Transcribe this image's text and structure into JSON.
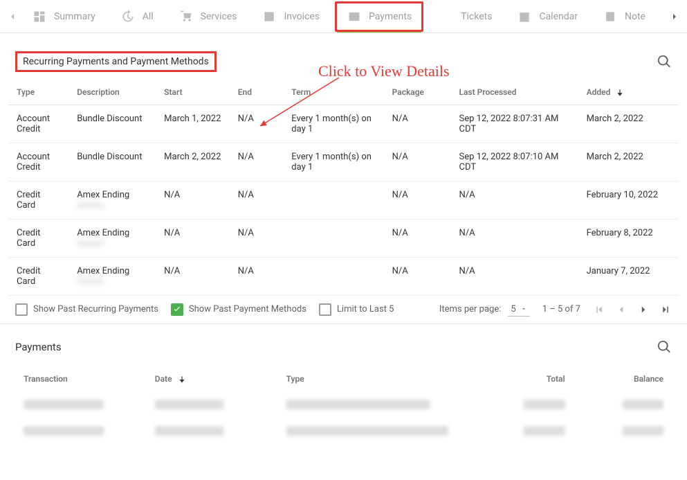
{
  "tabs": [
    {
      "label": "Summary",
      "icon": "dashboard",
      "active": false
    },
    {
      "label": "All",
      "icon": "history",
      "active": false
    },
    {
      "label": "Services",
      "icon": "cart",
      "active": false
    },
    {
      "label": "Invoices",
      "icon": "image",
      "active": false
    },
    {
      "label": "Payments",
      "icon": "card",
      "active": true
    },
    {
      "label": "Tickets",
      "icon": "ticket",
      "active": false
    },
    {
      "label": "Calendar",
      "icon": "calendar",
      "active": false
    },
    {
      "label": "Note",
      "icon": "note",
      "active": false
    }
  ],
  "annotation": "Click to View Details",
  "recurring": {
    "title": "Recurring Payments and Payment Methods",
    "columns": [
      "Type",
      "Description",
      "Start",
      "End",
      "Term",
      "Package",
      "Last Processed",
      "Added"
    ],
    "sort_column": "Added",
    "rows": [
      {
        "type": "Account Credit",
        "description": "Bundle Discount",
        "start": "March 1, 2022",
        "end": "N/A",
        "term": "Every 1 month(s) on day 1",
        "package": "N/A",
        "last_processed": "Sep 12, 2022 8:07:31 AM CDT",
        "added": "March 2, 2022",
        "desc_blur": false
      },
      {
        "type": "Account Credit",
        "description": "Bundle Discount",
        "start": "March 2, 2022",
        "end": "N/A",
        "term": "Every 1 month(s) on day 1",
        "package": "N/A",
        "last_processed": "Sep 12, 2022 8:07:10 AM CDT",
        "added": "March 2, 2022",
        "desc_blur": false
      },
      {
        "type": "Credit Card",
        "description": "Amex Ending",
        "start": "N/A",
        "end": "N/A",
        "term": "",
        "package": "N/A",
        "last_processed": "N/A",
        "added": "February 10, 2022",
        "desc_blur": true
      },
      {
        "type": "Credit Card",
        "description": "Amex Ending",
        "start": "N/A",
        "end": "N/A",
        "term": "",
        "package": "N/A",
        "last_processed": "N/A",
        "added": "February 8, 2022",
        "desc_blur": true
      },
      {
        "type": "Credit Card",
        "description": "Amex Ending",
        "start": "N/A",
        "end": "N/A",
        "term": "",
        "package": "N/A",
        "last_processed": "N/A",
        "added": "January 7, 2022",
        "desc_blur": true
      }
    ],
    "footer": {
      "show_past_recurring": {
        "label": "Show Past Recurring Payments",
        "checked": false
      },
      "show_past_methods": {
        "label": "Show Past Payment Methods",
        "checked": true
      },
      "limit_last_5": {
        "label": "Limit to Last 5",
        "checked": false
      },
      "items_per_page_label": "Items per page:",
      "items_per_page_value": "5",
      "range": "1 – 5 of 7"
    }
  },
  "payments": {
    "title": "Payments",
    "columns": [
      "Transaction",
      "Date",
      "Type",
      "Total",
      "Balance"
    ],
    "sort_column": "Date"
  }
}
